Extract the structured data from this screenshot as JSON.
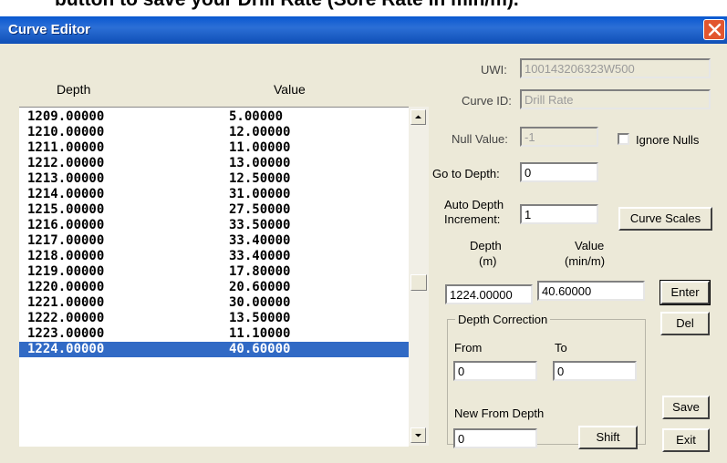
{
  "caption": "button to save your Drill Rate (Sore Rate in min/m).",
  "window": {
    "title": "Curve Editor"
  },
  "list": {
    "col_depth": "Depth",
    "col_value": "Value",
    "rows": [
      {
        "depth": "1209.00000",
        "value": "5.00000"
      },
      {
        "depth": "1210.00000",
        "value": "12.00000"
      },
      {
        "depth": "1211.00000",
        "value": "11.00000"
      },
      {
        "depth": "1212.00000",
        "value": "13.00000"
      },
      {
        "depth": "1213.00000",
        "value": "12.50000"
      },
      {
        "depth": "1214.00000",
        "value": "31.00000"
      },
      {
        "depth": "1215.00000",
        "value": "27.50000"
      },
      {
        "depth": "1216.00000",
        "value": "33.50000"
      },
      {
        "depth": "1217.00000",
        "value": "33.40000"
      },
      {
        "depth": "1218.00000",
        "value": "33.40000"
      },
      {
        "depth": "1219.00000",
        "value": "17.80000"
      },
      {
        "depth": "1220.00000",
        "value": "20.60000"
      },
      {
        "depth": "1221.00000",
        "value": "30.00000"
      },
      {
        "depth": "1222.00000",
        "value": "13.50000"
      },
      {
        "depth": "1223.00000",
        "value": "11.10000"
      },
      {
        "depth": "1224.00000",
        "value": "40.60000"
      }
    ],
    "selected_index": 15
  },
  "form": {
    "uwi_label": "UWI:",
    "uwi_value": "100143206323W500",
    "curve_id_label": "Curve ID:",
    "curve_id_value": "Drill Rate",
    "null_value_label": "Null Value:",
    "null_value": "-1",
    "ignore_nulls_label": "Ignore Nulls",
    "goto_label": "Go to Depth:",
    "goto_value": "0",
    "auto_inc_label_1": "Auto Depth",
    "auto_inc_label_2": "Increment:",
    "auto_inc_value": "1",
    "curve_scales": "Curve Scales",
    "depth_hdr_1": "Depth",
    "depth_hdr_2": "(m)",
    "value_hdr_1": "Value",
    "value_hdr_2": "(min/m)",
    "depth_input": "1224.00000",
    "value_input": "40.60000",
    "enter": "Enter",
    "del": "Del",
    "correction_title": "Depth Correction",
    "from_label": "From",
    "to_label": "To",
    "from_value": "0",
    "to_value": "0",
    "new_from_label": "New From Depth",
    "new_from_value": "0",
    "shift": "Shift",
    "save": "Save",
    "exit": "Exit"
  }
}
